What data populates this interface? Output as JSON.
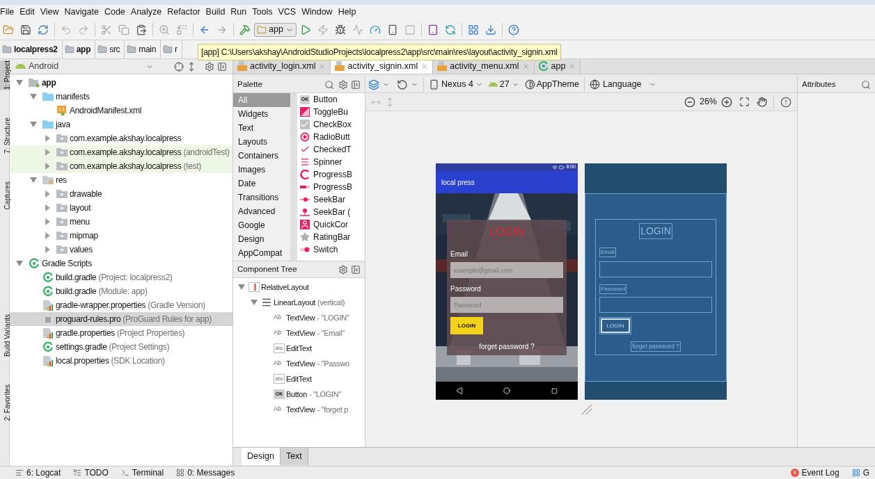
{
  "menu": [
    "File",
    "Edit",
    "View",
    "Navigate",
    "Code",
    "Analyze",
    "Refactor",
    "Build",
    "Run",
    "Tools",
    "VCS",
    "Window",
    "Help"
  ],
  "run_config": "app",
  "breadcrumbs": [
    "localpress2",
    "app",
    "src",
    "main",
    "r"
  ],
  "tooltip": "[app] C:\\Users\\akshay\\AndroidStudioProjects\\localpress2\\app\\src\\main\\res\\layout\\activity_signin.xml",
  "side_tabs": [
    {
      "label": "1: Project",
      "selected": true
    },
    {
      "label": "7: Structure",
      "selected": false
    },
    {
      "label": "Captures",
      "selected": false
    },
    {
      "label": "Build Variants",
      "selected": false
    },
    {
      "label": "2: Favorites",
      "selected": false
    }
  ],
  "project": {
    "view": "Android",
    "tree": [
      {
        "label": "app",
        "kind": "module",
        "expanded": true,
        "tinted": false,
        "selected": false,
        "children": [
          {
            "label": "manifests",
            "kind": "folder",
            "expanded": true,
            "tinted": false,
            "selected": false,
            "children": [
              {
                "label": "AndroidManifest.xml",
                "kind": "manifest",
                "tinted": false,
                "selected": false
              }
            ]
          },
          {
            "label": "java",
            "kind": "folder",
            "expanded": true,
            "tinted": false,
            "selected": false,
            "children": [
              {
                "label": "com.example.akshay.localpress",
                "kind": "package",
                "expanded": false,
                "tinted": false,
                "selected": false
              },
              {
                "label": "com.example.akshay.localpress",
                "note": "(androidTest)",
                "kind": "package",
                "expanded": false,
                "tinted": true,
                "selected": false
              },
              {
                "label": "com.example.akshay.localpress",
                "note": "(test)",
                "kind": "package",
                "expanded": false,
                "tinted": true,
                "selected": false
              }
            ]
          },
          {
            "label": "res",
            "kind": "res",
            "expanded": true,
            "tinted": false,
            "selected": false,
            "children": [
              {
                "label": "drawable",
                "kind": "package",
                "expanded": false,
                "tinted": false,
                "selected": false
              },
              {
                "label": "layout",
                "kind": "package",
                "expanded": false,
                "tinted": false,
                "selected": false
              },
              {
                "label": "menu",
                "kind": "package",
                "expanded": false,
                "tinted": false,
                "selected": false
              },
              {
                "label": "mipmap",
                "kind": "package",
                "expanded": false,
                "tinted": false,
                "selected": false
              },
              {
                "label": "values",
                "kind": "package",
                "expanded": false,
                "tinted": false,
                "selected": false
              }
            ]
          }
        ]
      },
      {
        "label": "Gradle Scripts",
        "kind": "gradle",
        "expanded": true,
        "tinted": false,
        "selected": false,
        "children": [
          {
            "label": "build.gradle",
            "note": "(Project: localpress2)",
            "kind": "gradle",
            "tinted": false,
            "selected": false
          },
          {
            "label": "build.gradle",
            "note": "(Module: app)",
            "kind": "gradle",
            "tinted": false,
            "selected": false
          },
          {
            "label": "gradle-wrapper.properties",
            "note": "(Gradle Version)",
            "kind": "props",
            "tinted": false,
            "selected": false
          },
          {
            "label": "proguard-rules.pro",
            "note": "(ProGuard Rules for app)",
            "kind": "file",
            "tinted": false,
            "selected": true
          },
          {
            "label": "gradle.properties",
            "note": "(Project Properties)",
            "kind": "props",
            "tinted": false,
            "selected": false
          },
          {
            "label": "settings.gradle",
            "note": "(Project Settings)",
            "kind": "gradle",
            "tinted": false,
            "selected": false
          },
          {
            "label": "local.properties",
            "note": "(SDK Location)",
            "kind": "props",
            "tinted": false,
            "selected": false
          }
        ]
      }
    ]
  },
  "editor_tabs": [
    {
      "label": "activity_login.xml",
      "kind": "xml",
      "selected": false
    },
    {
      "label": "activity_signin.xml",
      "kind": "xml",
      "selected": true
    },
    {
      "label": "activity_menu.xml",
      "kind": "xml",
      "selected": false
    },
    {
      "label": "app",
      "kind": "run",
      "selected": false
    }
  ],
  "palette": {
    "title": "Palette",
    "categories": [
      {
        "label": "All",
        "selected": true
      },
      {
        "label": "Widgets",
        "selected": false
      },
      {
        "label": "Text",
        "selected": false
      },
      {
        "label": "Layouts",
        "selected": false
      },
      {
        "label": "Containers",
        "selected": false
      },
      {
        "label": "Images",
        "selected": false
      },
      {
        "label": "Date",
        "selected": false
      },
      {
        "label": "Transitions",
        "selected": false
      },
      {
        "label": "Advanced",
        "selected": false
      },
      {
        "label": "Google",
        "selected": false
      },
      {
        "label": "Design",
        "selected": false
      },
      {
        "label": "AppCompat",
        "selected": false
      }
    ],
    "widgets": [
      {
        "label": "Button",
        "kind": "badge",
        "badge": "OK"
      },
      {
        "label": "ToggleBu",
        "kind": "toggle"
      },
      {
        "label": "CheckBox",
        "kind": "checkbox"
      },
      {
        "label": "RadioButt",
        "kind": "radio"
      },
      {
        "label": "CheckedT",
        "kind": "checked"
      },
      {
        "label": "Spinner",
        "kind": "spinner"
      },
      {
        "label": "ProgressB",
        "kind": "ring"
      },
      {
        "label": "ProgressB",
        "kind": "bar"
      },
      {
        "label": "SeekBar",
        "kind": "seek"
      },
      {
        "label": "SeekBar (",
        "kind": "seekd"
      },
      {
        "label": "QuickCor",
        "kind": "person"
      },
      {
        "label": "RatingBar",
        "kind": "star"
      },
      {
        "label": "Switch",
        "kind": "switch"
      }
    ]
  },
  "component_tree": {
    "title": "Component Tree",
    "items": [
      {
        "label": "RelativeLayout",
        "kind": "relative",
        "expanded": true,
        "children": [
          {
            "label": "LinearLayout",
            "note": "(vertical)",
            "kind": "linear",
            "expanded": true,
            "children": [
              {
                "label": "TextView",
                "note": "- \"LOGIN\"",
                "kind": "badge",
                "badge": "Ab"
              },
              {
                "label": "TextView",
                "note": "- \"Email\"",
                "kind": "badge",
                "badge": "Ab"
              },
              {
                "label": "EditText",
                "kind": "boxed",
                "badge": "abc"
              },
              {
                "label": "TextView",
                "note": "- \"Passwo",
                "kind": "badge",
                "badge": "Ab"
              },
              {
                "label": "EditText",
                "kind": "boxed",
                "badge": "abc"
              },
              {
                "label": "Button",
                "note": "- \"LOGIN\"",
                "kind": "filled",
                "badge": "OK"
              },
              {
                "label": "TextView",
                "note": "- \"forget p",
                "kind": "badge",
                "badge": "Ab"
              }
            ]
          }
        ]
      }
    ]
  },
  "design_toolbar": {
    "device": "Nexus 4",
    "api": "27",
    "theme": "AppTheme",
    "language": "Language",
    "zoom": "26%"
  },
  "attributes_title": "Attributes",
  "preview": {
    "time": "8:00",
    "app_title": "local press",
    "heading": "LOGIN",
    "email_label": "Email",
    "email_placeholder": "example@gmail.com",
    "password_label": "Password",
    "password_placeholder": "Password",
    "button": "LOGIN",
    "link": "forget password ?"
  },
  "blueprint": {
    "heading": "LOGIN",
    "email_label": "Email",
    "password_label": "Password",
    "button": "LOGIN",
    "link": "forget password ?"
  },
  "bottom_tabs": [
    {
      "label": "Design",
      "selected": true
    },
    {
      "label": "Text",
      "selected": false
    }
  ],
  "status_items": [
    {
      "label": "6: Logcat",
      "kind": "logcat"
    },
    {
      "label": "TODO",
      "kind": "todo"
    },
    {
      "label": "Terminal",
      "kind": "terminal"
    },
    {
      "label": "0: Messages",
      "kind": "messages"
    }
  ],
  "event_log": {
    "count": "9",
    "label": "Event Log"
  },
  "status_cut": "G"
}
